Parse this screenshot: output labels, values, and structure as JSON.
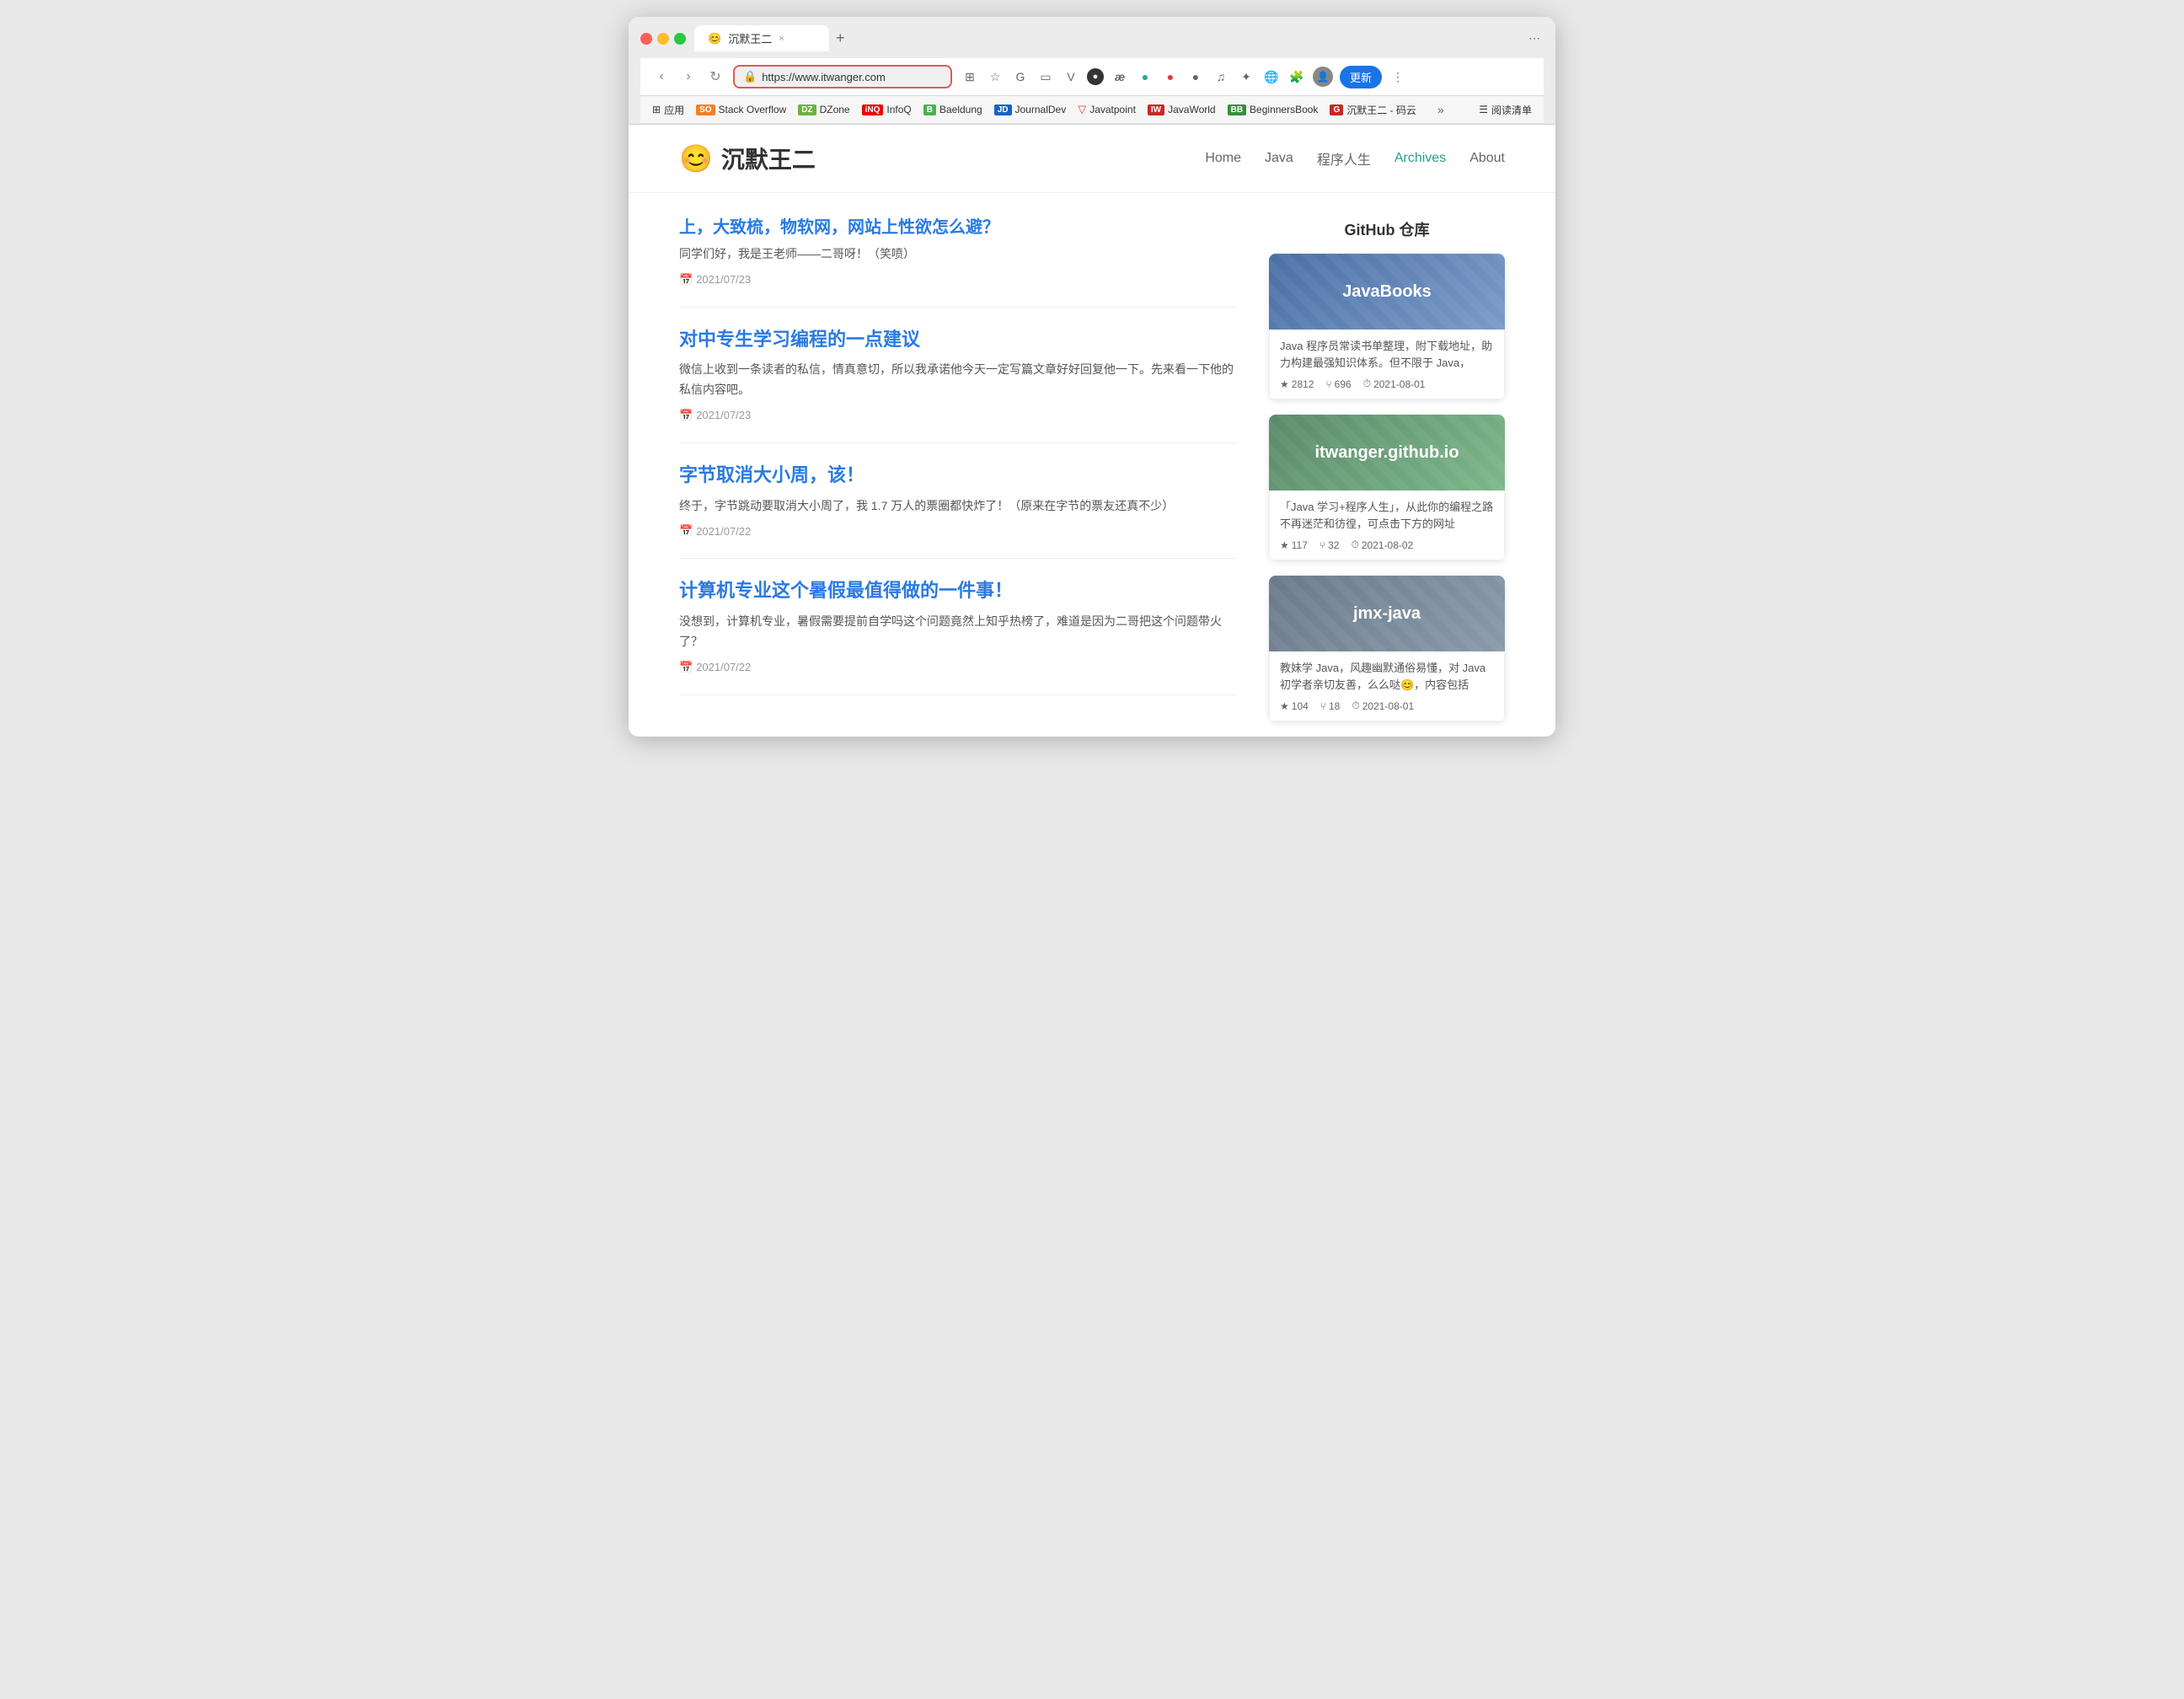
{
  "browser": {
    "tab_title": "沉默王二",
    "tab_close": "×",
    "tab_new": "+",
    "nav": {
      "back": "‹",
      "forward": "›",
      "refresh": "↻",
      "url": "https://www.itwanger.com",
      "lock_icon": "🔒"
    },
    "update_btn": "更新",
    "bookmarks": [
      {
        "label": "应用",
        "icon": "⊞"
      },
      {
        "label": "Stack Overflow",
        "icon": "SO"
      },
      {
        "label": "DZone",
        "icon": "DZ"
      },
      {
        "label": "InfoQ",
        "icon": "iQ"
      },
      {
        "label": "Baeldung",
        "icon": "B"
      },
      {
        "label": "JournalDev",
        "icon": "JD"
      },
      {
        "label": "Javatpoint",
        "icon": "▽"
      },
      {
        "label": "JavaWorld",
        "icon": "IW"
      },
      {
        "label": "BeginnersBook",
        "icon": "BB"
      },
      {
        "label": "沉默王二 - 码云",
        "icon": "G"
      }
    ],
    "reading_list": "阅读清单"
  },
  "site": {
    "logo_emoji": "😊",
    "logo_text": "沉默王二",
    "nav_links": [
      {
        "label": "Home",
        "active": false
      },
      {
        "label": "Java",
        "active": false
      },
      {
        "label": "程序人生",
        "active": false
      },
      {
        "label": "Archives",
        "active": true
      },
      {
        "label": "About",
        "active": false
      }
    ]
  },
  "articles": [
    {
      "title_truncated": "上，大致梳，物软网，网站上性欲怎么避？",
      "excerpt": "同学们好，我是王老师——二哥呀！（笑喷）",
      "date": "2021/07/23"
    },
    {
      "title": "对中专生学习编程的一点建议",
      "excerpt": "微信上收到一条读者的私信，情真意切，所以我承诺他今天一定写篇文章好好回复他一下。先来看一下他的私信内容吧。",
      "date": "2021/07/23"
    },
    {
      "title": "字节取消大小周，该！",
      "excerpt": "终于，字节跳动要取消大小周了，我 1.7 万人的票圈都快炸了！（原来在字节的票友还真不少）",
      "date": "2021/07/22"
    },
    {
      "title": "计算机专业这个暑假最值得做的一件事！",
      "excerpt": "没想到，计算机专业，暑假需要提前自学吗这个问题竟然上知乎热榜了，难道是因为二哥把这个问题带火了？",
      "date": "2021/07/22"
    }
  ],
  "sidebar": {
    "github_title": "GitHub 仓库",
    "repos": [
      {
        "name": "JavaBooks",
        "color_class": "blue",
        "description": "Java 程序员常读书单整理，附下载地址，助力构建最强知识体系。但不限于 Java，",
        "stars": "2812",
        "forks": "696",
        "date": "2021-08-01"
      },
      {
        "name": "itwanger.github.io",
        "color_class": "green",
        "description": "「Java 学习+程序人生」，从此你的编程之路不再迷茫和彷徨，可点击下方的网址",
        "stars": "117",
        "forks": "32",
        "date": "2021-08-02"
      },
      {
        "name": "jmx-java",
        "color_class": "slate",
        "description": "教妹学 Java，风趣幽默通俗易懂，对 Java 初学者亲切友善，么么哒😊，内容包括",
        "stars": "104",
        "forks": "18",
        "date": "2021-08-01"
      }
    ]
  },
  "date_icon": "📅",
  "star_icon": "★",
  "fork_icon": "⑂"
}
